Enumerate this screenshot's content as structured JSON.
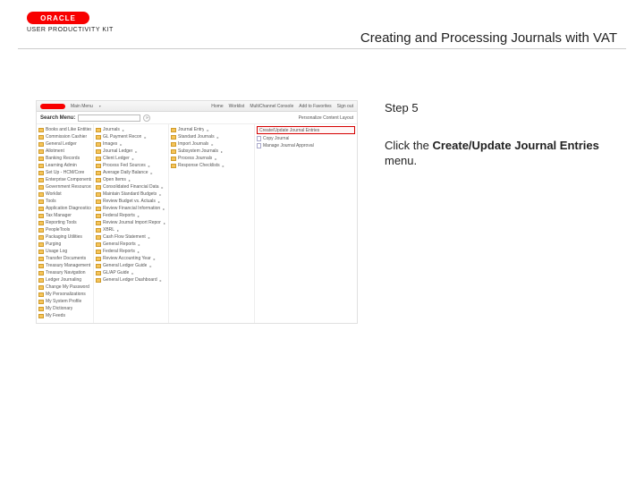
{
  "logo": {
    "brand": "ORACLE",
    "sub": "USER PRODUCTIVITY KIT"
  },
  "title": "Creating and Processing Journals with VAT",
  "step": "Step 5",
  "instruction_pre": "Click the ",
  "instruction_bold": "Create/Update Journal Entries",
  "instruction_post": " menu.",
  "app": {
    "topbar": {
      "mainMenu": "Main Menu",
      "links": [
        "Home",
        "Worklist",
        "MultiChannel Console",
        "Add to Favorites",
        "Sign out"
      ]
    },
    "search": {
      "label": "Search Menu:",
      "go": "»"
    },
    "personalize": "Personalize Content  Layout",
    "col_a": [
      "Books and Like Entities",
      "Commission Cashier",
      "General Ledger",
      "Allotment",
      "Banking Records",
      "Learning Admin",
      "Set Up - HCM/Core",
      "Enterprise Components",
      "Government Resources",
      "Worklist",
      "Tools",
      "Application Diagnostics",
      "Tax Manager",
      "Reporting Tools",
      "PeopleTools",
      "Packaging Utilities",
      "Purging",
      "Usage Log",
      "Transfer Documents",
      "Treasury Management",
      "Treasury Navigation",
      "Ledger Journaling",
      "Change My Password",
      "My Personalizations",
      "My System Profile",
      "My Dictionary",
      "My Feeds"
    ],
    "col_b": [
      "Journals",
      "GL Payment Recon",
      "Images",
      "Journal Ledger",
      "Client Ledger",
      "Process Fed Sources",
      "Average Daily Balance",
      "Open Items",
      "Consolidated Financial Data",
      "Maintain Standard Budgets",
      "Review Budget vs. Actuals",
      "Review Financial Information",
      "Federal Reports",
      "Review Journal Import Reports",
      "XBRL",
      "Cash Flow Statement",
      "General Reports",
      "Federal Reports",
      "Review Accounting Year",
      "General Ledger Guide",
      "GL/AP Guide",
      "General Ledger Dashboard"
    ],
    "col_c": [
      "Journal Entry",
      "Standard Journals",
      "Import Journals",
      "Subsystem Journals",
      "Process Journals",
      "Response Checklists"
    ],
    "col_d_title": "Create/Update Journal Entries",
    "col_d": [
      "Copy Journal",
      "Manage Journal Approval"
    ]
  }
}
